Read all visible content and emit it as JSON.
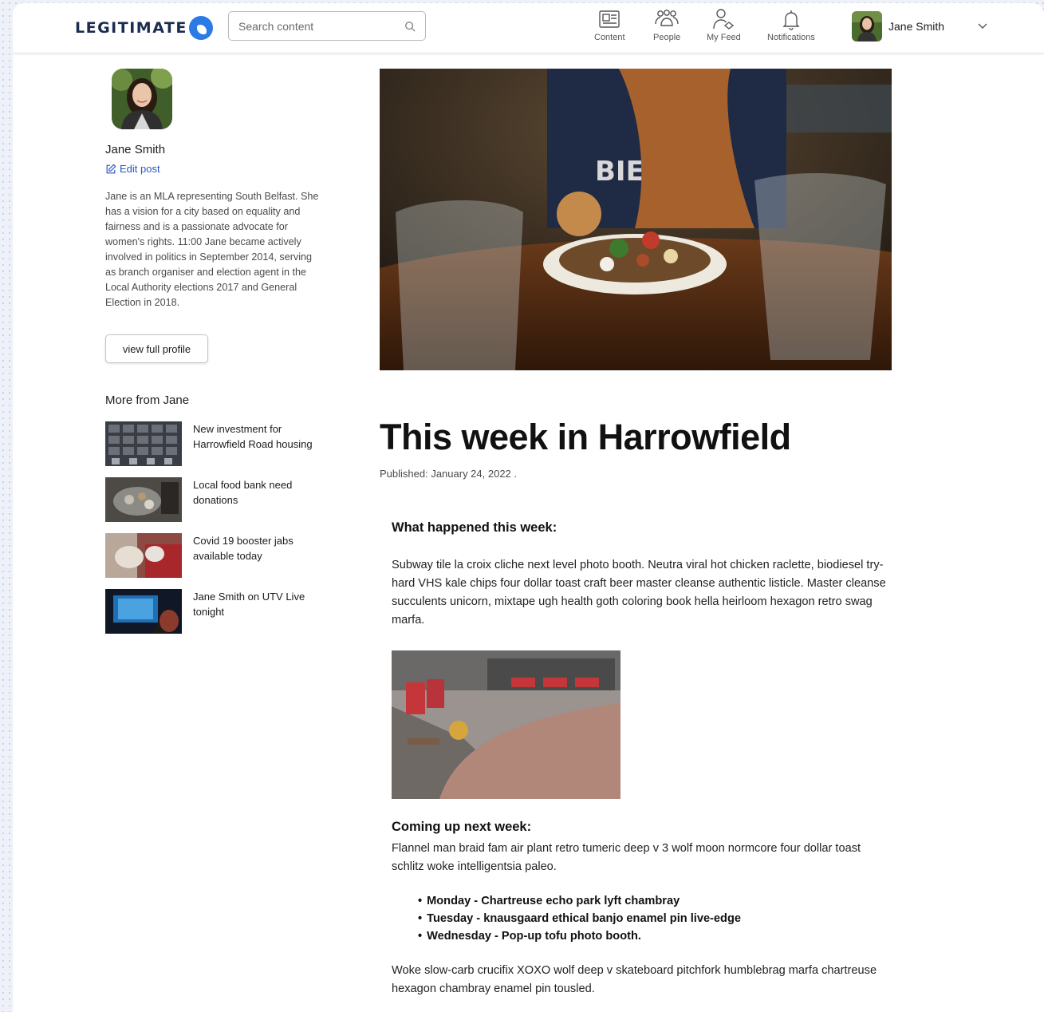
{
  "header": {
    "logo_text": "LEGITIMATE",
    "search_placeholder": "Search content",
    "nav": [
      {
        "label": "Content",
        "icon": "newspaper-icon"
      },
      {
        "label": "People",
        "icon": "people-icon"
      },
      {
        "label": "My Feed",
        "icon": "user-feed-icon"
      },
      {
        "label": "Notifications",
        "icon": "bell-icon"
      }
    ],
    "user_name": "Jane Smith"
  },
  "sidebar": {
    "author_name": "Jane Smith",
    "edit_label": "Edit post",
    "bio": "Jane is an MLA representing South Belfast. She has a vision for a city based on equality and fairness and is a passionate advocate for women's rights. 11:00 Jane became actively involved in politics in September 2014, serving as branch organiser and election agent in the Local Authority elections 2017 and General Election in 2018.",
    "profile_button": "view full profile",
    "more_title": "More from Jane",
    "more_items": [
      {
        "title": "New investment for Harrowfield Road housing"
      },
      {
        "title": "Local food bank need donations"
      },
      {
        "title": "Covid 19 booster jabs available today"
      },
      {
        "title": "Jane Smith on UTV Live tonight"
      }
    ]
  },
  "post": {
    "title": "This week in Harrowfield",
    "published": "Published: January 24, 2022 .",
    "section1_heading": "What happened this week:",
    "section1_text": "Subway tile la croix cliche next level photo booth. Neutra viral hot chicken raclette, biodiesel try-hard VHS kale chips four dollar toast craft beer master cleanse authentic listicle. Master cleanse succulents unicorn, mixtape ugh health goth coloring book hella heirloom hexagon retro swag marfa.",
    "section2_heading": "Coming up next week:",
    "section2_text": "Flannel man braid fam air plant retro tumeric deep v 3 wolf moon normcore four dollar toast schlitz woke intelligentsia paleo.",
    "schedule": [
      "Monday - Chartreuse echo park lyft chambray",
      "Tuesday - knausgaard ethical banjo enamel pin live-edge",
      "Wednesday - Pop-up tofu photo booth."
    ],
    "closing_text": "Woke slow-carb crucifix XOXO wolf deep v skateboard pitchfork humblebrag marfa chartreuse hexagon chambray enamel pin tousled."
  },
  "colors": {
    "link": "#2356c7",
    "logo_mark": "#2c7be5",
    "logo_text": "#1b2d4f"
  }
}
